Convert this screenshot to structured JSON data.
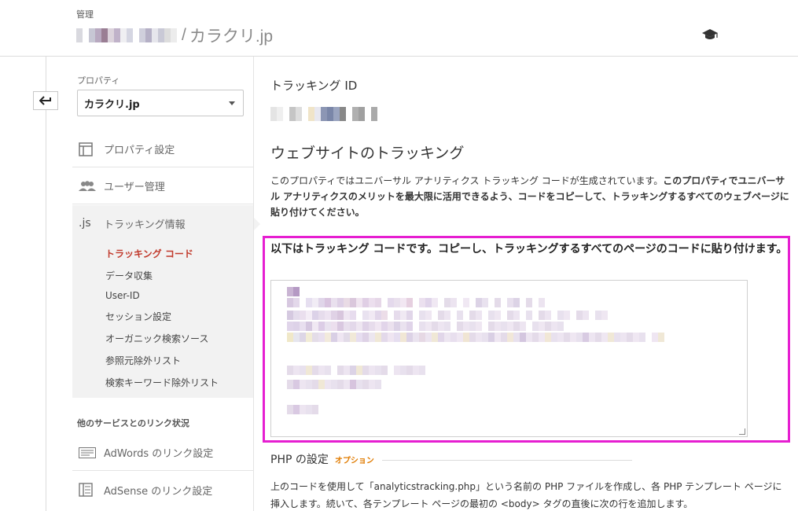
{
  "header": {
    "section_label": "管理",
    "separator": "/",
    "site_name": "カラクリ.jp"
  },
  "sidebar": {
    "property_label": "プロパティ",
    "property_selected": "カラクリ.jp",
    "items": [
      {
        "label": "プロパティ設定",
        "icon": "window-icon"
      },
      {
        "label": "ユーザー管理",
        "icon": "users-icon"
      },
      {
        "label": "トラッキング情報",
        "icon": "js-icon",
        "icon_text": ".js"
      }
    ],
    "sub_items": [
      "トラッキング コード",
      "データ収集",
      "User-ID",
      "セッション設定",
      "オーガニック検索ソース",
      "参照元除外リスト",
      "検索キーワード除外リスト"
    ],
    "links_section_label": "他のサービスとのリンク状況",
    "link_items": [
      {
        "label": "AdWords のリンク設定",
        "icon": "adwords-icon"
      },
      {
        "label": "AdSense のリンク設定",
        "icon": "adsense-icon"
      }
    ]
  },
  "main": {
    "tracking_id_label": "トラッキング ID",
    "website_tracking_heading": "ウェブサイトのトラッキング",
    "desc_normal": "このプロパティではユニバーサル アナリティクス トラッキング コードが生成されています。",
    "desc_bold": "このプロパティでユニバーサル アナリティクスのメリットを最大限に活用できるよう、コードをコピーして、トラッキングするすべてのウェブページに貼り付けてください。",
    "code_title": "以下はトラッキング コードです。コピーし、トラッキングするすべてのページのコードに貼り付けます。",
    "php_title": "PHP の設定",
    "php_option": "オプション",
    "php_desc": "上のコードを使用して「analyticstracking.php」という名前の PHP ファイルを作成し、各 PHP テンプレート ページに挿入します。続いて、各テンプレート ページの最初の <body> タグの直後に次の行を追加します。"
  },
  "colors": {
    "accent_red": "#c13a2c",
    "highlight_magenta": "#e61ed1",
    "option_orange": "#e07b00"
  }
}
